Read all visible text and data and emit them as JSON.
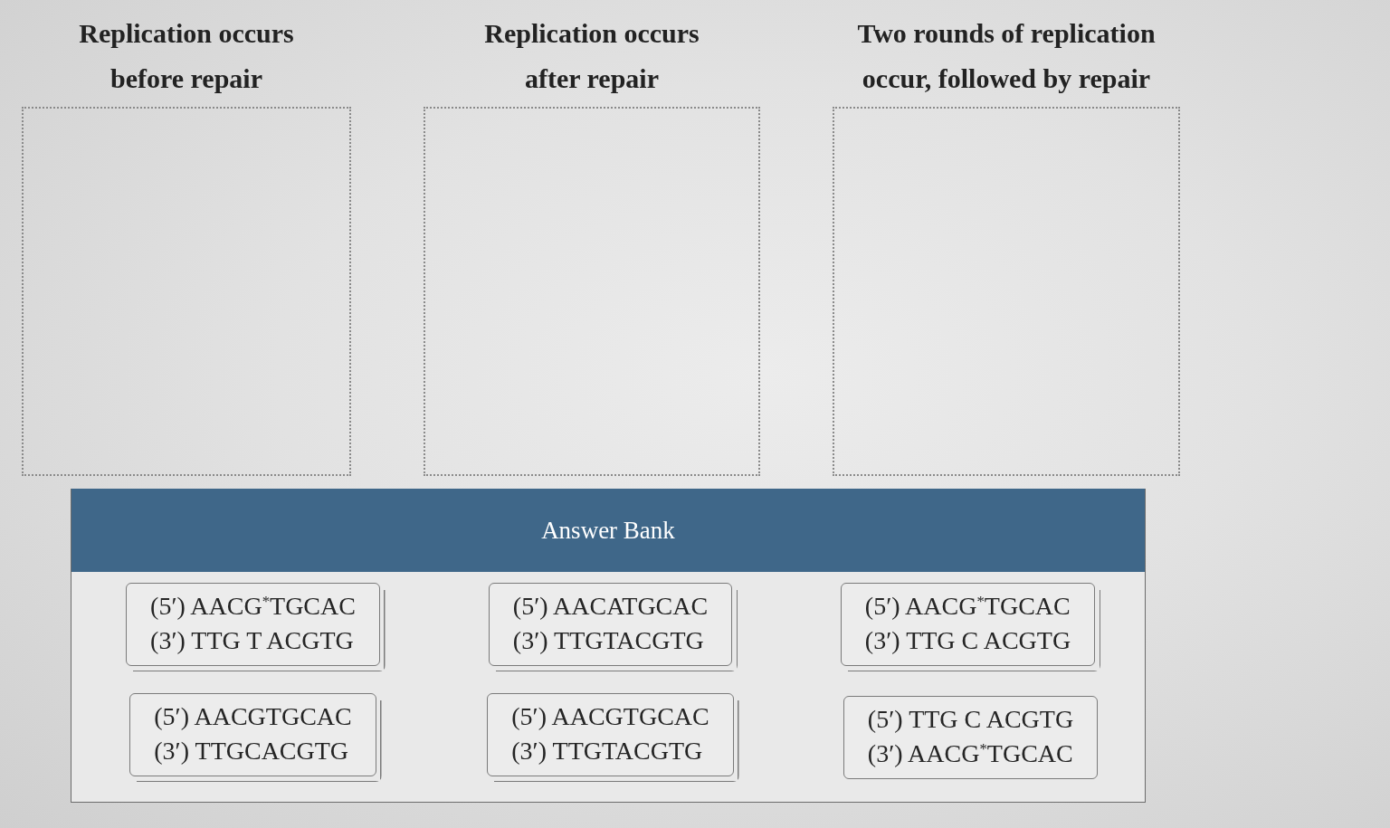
{
  "categories": [
    {
      "heading_lines": [
        "Replication occurs",
        "before repair"
      ]
    },
    {
      "heading_lines": [
        "Replication occurs",
        "after repair"
      ]
    },
    {
      "heading_lines": [
        "Two rounds of replication",
        "occur, followed by repair"
      ]
    }
  ],
  "answer_bank": {
    "title": "Answer Bank",
    "cards": [
      {
        "lines": [
          "(5′) AACG$^{*}$TGCAC",
          "(3′) TTG T ACGTG"
        ],
        "stacked": true
      },
      {
        "lines": [
          "(5′) AACATGCAC",
          "(3′) TTGTACGTG"
        ],
        "stacked": true
      },
      {
        "lines": [
          "(5′) AACG$^{*}$TGCAC",
          "(3′) TTG C ACGTG"
        ],
        "stacked": true
      },
      {
        "lines": [
          "(5′) AACGTGCAC",
          "(3′) TTGCACGTG"
        ],
        "stacked": true
      },
      {
        "lines": [
          "(5′) AACGTGCAC",
          "(3′) TTGTACGTG"
        ],
        "stacked": true
      },
      {
        "lines": [
          "(5′) TTG C ACGTG",
          "(3′) AACG$^{*}$TGCAC"
        ],
        "stacked": false
      }
    ]
  }
}
